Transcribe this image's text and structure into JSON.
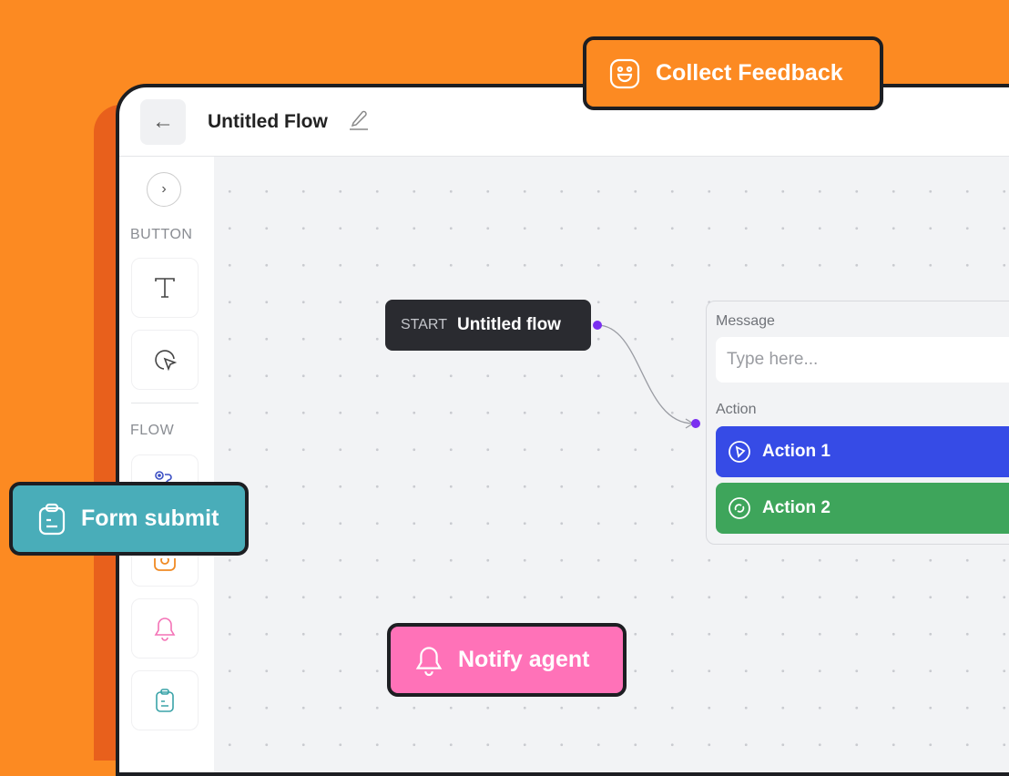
{
  "header": {
    "title": "Untitled Flow",
    "back_icon": "arrow-left-icon",
    "edit_icon": "pencil-icon"
  },
  "sidebar": {
    "expand_icon": "chevron-right-icon",
    "sections": [
      {
        "label": "BUTTON",
        "items": [
          {
            "icon": "text-icon"
          },
          {
            "icon": "cursor-click-icon"
          }
        ]
      },
      {
        "label": "FLOW",
        "items": [
          {
            "icon": "route-icon",
            "color": "#3b4fc4"
          },
          {
            "icon": "instagram-icon",
            "color": "#f08a24"
          },
          {
            "icon": "bell-icon",
            "color": "#f472b6"
          },
          {
            "icon": "clipboard-icon",
            "color": "#3aa3a8"
          }
        ]
      }
    ]
  },
  "canvas": {
    "start_node": {
      "kicker": "START",
      "title": "Untitled flow"
    },
    "message_card": {
      "message_label": "Message",
      "message_placeholder": "Type here...",
      "action_label": "Action",
      "actions": [
        {
          "label": "Action 1",
          "icon": "play-circle-icon",
          "color": "#364be6"
        },
        {
          "label": "Action 2",
          "icon": "swirl-icon",
          "color": "#3ea55b"
        }
      ]
    }
  },
  "badges": {
    "collect_feedback": {
      "label": "Collect Feedback",
      "icon": "smiley-icon",
      "color": "#FC8A22"
    },
    "form_submit": {
      "label": "Form submit",
      "icon": "clipboard-icon",
      "color": "#49adb9"
    },
    "notify_agent": {
      "label": "Notify agent",
      "icon": "bell-icon",
      "color": "#ff72b8"
    }
  },
  "colors": {
    "background": "#FC8A22",
    "accent_dot": "#7a2ff0"
  }
}
